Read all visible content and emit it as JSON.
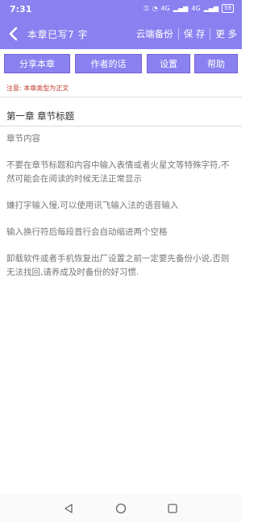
{
  "status_bar": {
    "time": "7:31",
    "signal_1": "4G",
    "signal_2": "4G",
    "battery": "59"
  },
  "header": {
    "title": "本章已写7 字",
    "cloud_backup": "云端备份",
    "save": "保 存",
    "more": "更 多"
  },
  "toolbar": {
    "share": "分享本章",
    "author_note": "作者的话",
    "settings": "设置",
    "help": "帮助"
  },
  "notice": "注意: 本章类型为正文",
  "chapter": {
    "title": "第一章 章节标题",
    "paragraphs": [
      "章节内容",
      "不要在章节标题和内容中输入表情或者火星文等特殊字符,不然可能会在阅读的时候无法正常显示",
      "嫌打字输入慢,可以使用讯飞输入法的语音输入",
      "输入换行符后每段首行会自动缩进两个空格",
      "卸载软件或者手机恢复出厂设置之前一定要先备份小说,否则无法找回,请养成及时备份的好习惯."
    ]
  },
  "colors": {
    "accent": "#8b80f0",
    "notice": "#c0392b"
  }
}
